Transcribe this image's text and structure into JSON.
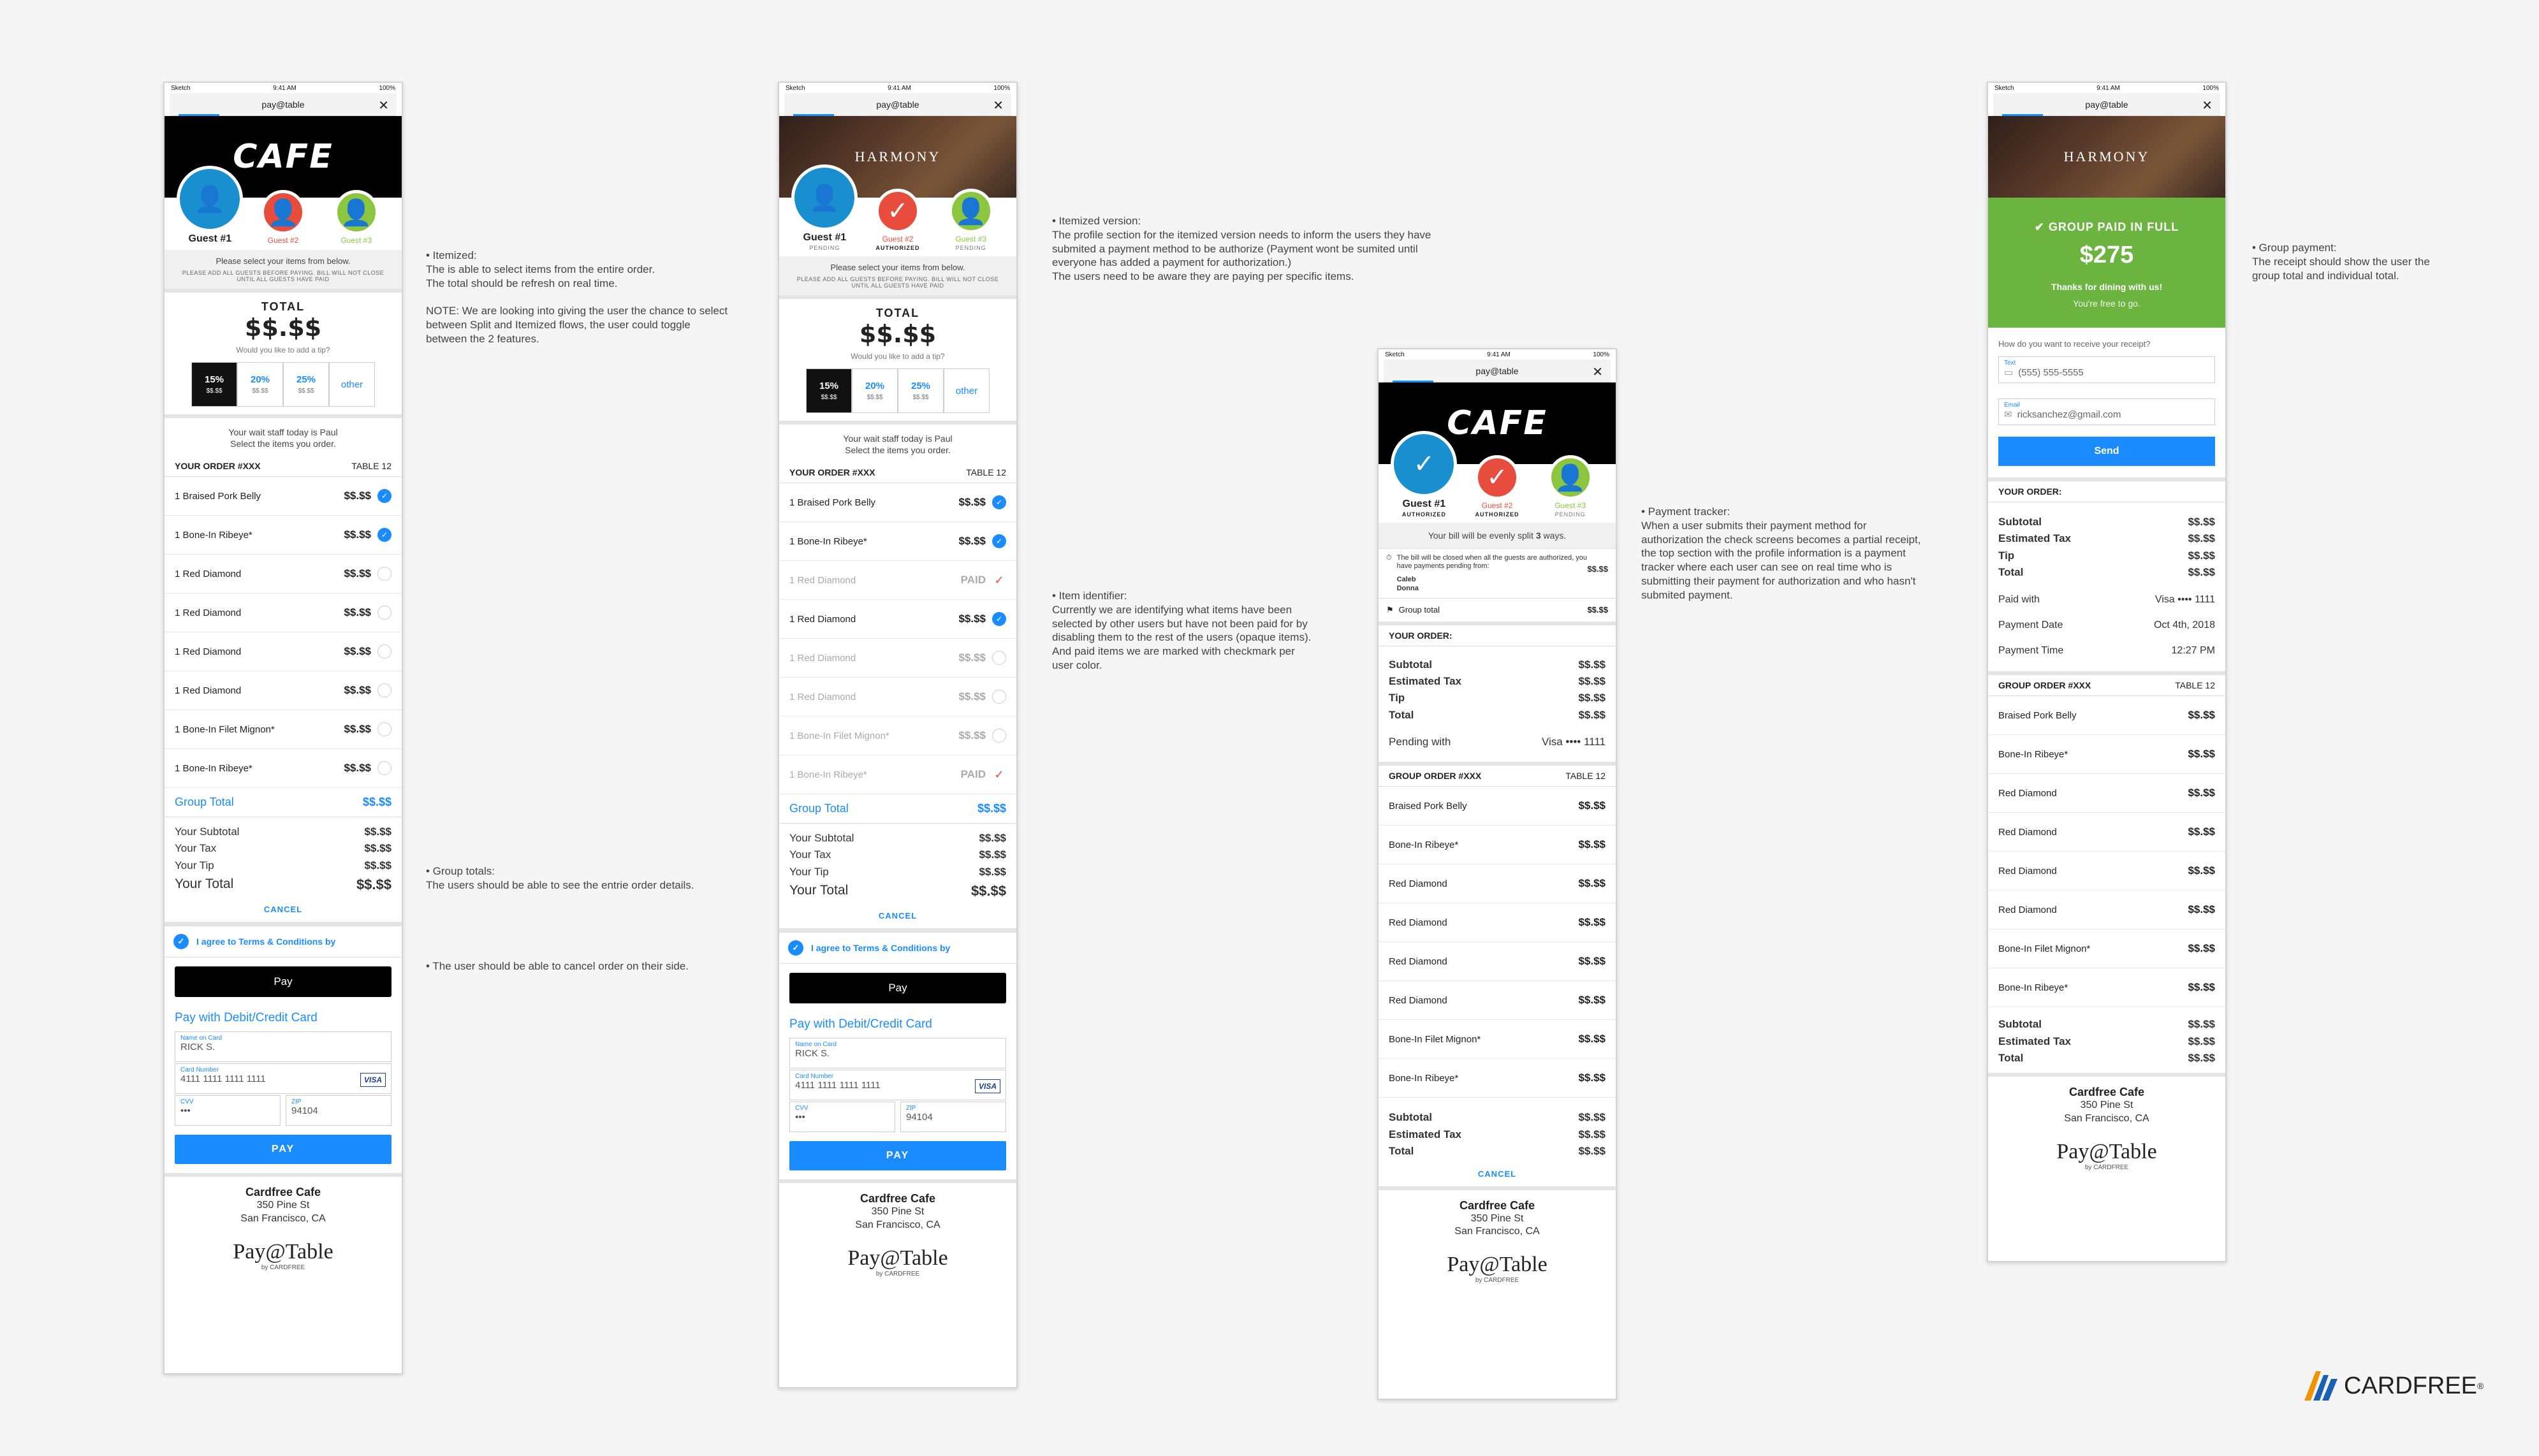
{
  "status": {
    "carrier": "Sketch",
    "time": "9:41 AM",
    "battery": "100%"
  },
  "app_title": "pay@table",
  "s1": {
    "logo": "CAFE",
    "guests": [
      {
        "name": "Guest #1"
      },
      {
        "name": "Guest #2"
      },
      {
        "name": "Guest #3"
      }
    ],
    "select_note": "Please select your items from below.",
    "fine": "PLEASE ADD ALL GUESTS BEFORE PAYING. BILL WILL NOT CLOSE UNTIL ALL GUESTS HAVE PAID",
    "total_label": "TOTAL",
    "total_value": "$$.$$",
    "tip_q": "Would you like to add a tip?",
    "tips": [
      {
        "p": "15%",
        "a": "$$.$$"
      },
      {
        "p": "20%",
        "a": "$$.$$"
      },
      {
        "p": "25%",
        "a": "$$.$$"
      }
    ],
    "tip_other": "other",
    "wait1": "Your wait staff today is Paul",
    "wait2": "Select the items you order.",
    "order": "YOUR ORDER #XXX",
    "table": "TABLE 12",
    "items": [
      {
        "n": "1 Braised Pork Belly",
        "p": "$$.$$"
      },
      {
        "n": "1 Bone-In Ribeye*",
        "p": "$$.$$"
      },
      {
        "n": "1 Red Diamond",
        "p": "$$.$$"
      },
      {
        "n": "1 Red Diamond",
        "p": "$$.$$"
      },
      {
        "n": "1 Red Diamond",
        "p": "$$.$$"
      },
      {
        "n": "1 Red Diamond",
        "p": "$$.$$"
      },
      {
        "n": "1 Bone-In Filet Mignon*",
        "p": "$$.$$"
      },
      {
        "n": "1 Bone-In Ribeye*",
        "p": "$$.$$"
      }
    ],
    "group_total": "Group Total",
    "group_total_v": "$$.$$",
    "sub": "Your Subtotal",
    "tax": "Your Tax",
    "tip": "Your Tip",
    "your_total": "Your Total",
    "amt": "$$.$$",
    "cancel": "CANCEL",
    "agree": "I agree to Terms & Conditions by",
    "apple": " Pay",
    "pay_cc": "Pay with Debit/Credit Card",
    "name_l": "Name on Card",
    "name_v": "RICK S.",
    "card_l": "Card Number",
    "card_v": "4111 1111 1111 1111",
    "visa": "VISA",
    "cvv_l": "CVV",
    "cvv_v": "•••",
    "zip_l": "ZIP",
    "zip_v": "94104",
    "pay": "PAY"
  },
  "s2": {
    "logo": "HARMONY",
    "guests": [
      {
        "name": "Guest #1",
        "st": "PENDING"
      },
      {
        "name": "Guest #2",
        "st": "AUTHORIZED"
      },
      {
        "name": "Guest #3",
        "st": "PENDING"
      }
    ],
    "paid": "PAID",
    "items": [
      {
        "n": "1 Braised Pork Belly",
        "p": "$$.$$"
      },
      {
        "n": "1 Bone-In Ribeye*",
        "p": "$$.$$"
      },
      {
        "n": "1 Red Diamond",
        "p": "PAID"
      },
      {
        "n": "1 Red Diamond",
        "p": "$$.$$"
      },
      {
        "n": "1 Red Diamond",
        "p": "$$.$$"
      },
      {
        "n": "1 Red Diamond",
        "p": "$$.$$"
      },
      {
        "n": "1 Bone-In Filet Mignon*",
        "p": "$$.$$"
      },
      {
        "n": "1 Bone-In Ribeye*",
        "p": "PAID"
      }
    ]
  },
  "s3": {
    "guests": [
      {
        "name": "Guest #1",
        "st": "AUTHORIZED"
      },
      {
        "name": "Guest #2",
        "st": "AUTHORIZED"
      },
      {
        "name": "Guest #3",
        "st": "PENDING"
      }
    ],
    "split_pre": "Your bill will be evenly split ",
    "split_n": "3",
    "split_post": " ways.",
    "pend_text": "The bill will be closed when all the guests are authorized, you have payments pending from:",
    "pend_names": "Caleb\nDonna",
    "pend_amt": "$$.$$",
    "group_total": "Group total",
    "group_total_v": "$$.$$",
    "your_order": "YOUR ORDER:",
    "subtotal": "Subtotal",
    "est_tax": "Estimated Tax",
    "tip": "Tip",
    "total": "Total",
    "pending_with": "Pending with",
    "visa_mask": "Visa •••• 1111",
    "group_order": "GROUP ORDER #XXX",
    "table": "TABLE 12",
    "items": [
      "Braised Pork Belly",
      "Bone-In Ribeye*",
      "Red Diamond",
      "Red Diamond",
      "Red Diamond",
      "Red Diamond",
      "Bone-In Filet Mignon*",
      "Bone-In Ribeye*"
    ]
  },
  "s4": {
    "paid_full": "GROUP PAID IN FULL",
    "amount": "$275",
    "thanks": "Thanks for dining with us!",
    "free": "You're free to go.",
    "receipt_q": "How do you want to receive your receipt?",
    "text_l": "Text",
    "text_v": "(555) 555-5555",
    "email_l": "Email",
    "email_v": "ricksanchez@gmail.com",
    "send": "Send",
    "paid_with": "Paid with",
    "pay_date": "Payment Date",
    "pay_date_v": "Oct 4th, 2018",
    "pay_time": "Payment Time",
    "pay_time_v": "12:27 PM"
  },
  "footer": {
    "name": "Cardfree Cafe",
    "addr1": "350 Pine St",
    "addr2": "San Francisco, CA",
    "brand": "Pay@Table",
    "by": "by CARDFREE"
  },
  "annotations": {
    "a1": "• Itemized:\nThe is able to select items from the entire order.\nThe total should be refresh on real time.\n\nNOTE: We are looking into giving the user the chance to select between Split and Itemized flows, the user could toggle between the 2 features.",
    "a2": "• Group totals:\nThe users should be able to see the entrie order details.",
    "a3": "• The user should be able to cancel order on their side.",
    "a4": "• Itemized version:\nThe profile section for the itemized version needs to inform the users they have submited a payment method to be authorize (Payment wont be sumited until everyone has added a payment for authorization.)\nThe users need to be aware they are paying per specific items.",
    "a5": "• Item identifier:\nCurrently we are identifying what items have been selected by other users but have not been paid for by disabling them to the rest of the users (opaque items).\nAnd paid items we are marked with checkmark per user color.",
    "a6": "• Payment tracker:\nWhen a user submits their payment method for authorization the check screens becomes a partial receipt, the top section with the profile information is a payment tracker where each user can see on real time who is submitting their payment for authorization and who hasn't submited payment.",
    "a7": "• Group payment:\nThe receipt should show the user the group total and individual total."
  },
  "brand": "CARDFREE",
  "colors": {
    "blue": "#1a8cff",
    "guest1": "#1a8fd0",
    "guest2": "#e84c3d",
    "guest3": "#8cc63f",
    "green": "#6bb43f"
  }
}
